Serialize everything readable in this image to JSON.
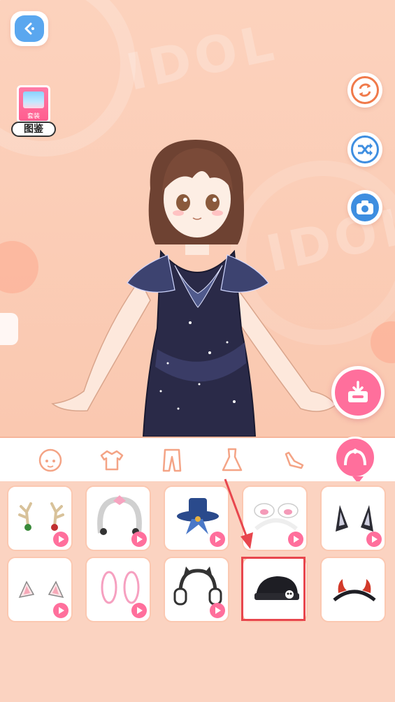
{
  "header": {
    "back_icon": "back-arrow-icon",
    "watermark": "IDOL"
  },
  "album": {
    "icon": "album-book-icon",
    "book_text": "套装",
    "label": "图鉴"
  },
  "side_buttons": [
    {
      "icon": "refresh-icon",
      "color": "#f07a4a"
    },
    {
      "icon": "shuffle-icon",
      "color": "#3e8ee0"
    },
    {
      "icon": "camera-icon",
      "color": "#3e8ee0"
    }
  ],
  "save_button": {
    "icon": "download-box-icon",
    "color": "#ff6f9c"
  },
  "categories": [
    {
      "icon": "face-icon"
    },
    {
      "icon": "top-icon"
    },
    {
      "icon": "pants-icon"
    },
    {
      "icon": "dress-icon"
    },
    {
      "icon": "shoes-icon"
    },
    {
      "icon": "headband-icon",
      "active": true
    }
  ],
  "items": [
    {
      "icon": "antler-headpiece-icon"
    },
    {
      "icon": "lace-headdress-icon"
    },
    {
      "icon": "blue-mini-hat-icon"
    },
    {
      "icon": "bunny-ear-headband-icon"
    },
    {
      "icon": "black-cat-ears-icon"
    },
    {
      "icon": "pink-cat-ears-icon"
    },
    {
      "icon": "pink-hair-clips-icon"
    },
    {
      "icon": "cat-ear-headphones-icon"
    },
    {
      "icon": "skull-cap-icon",
      "selected": true
    },
    {
      "icon": "devil-horns-headband-icon"
    }
  ],
  "colors": {
    "accent": "#ff6f9c",
    "highlight": "#e8464d",
    "background": "#fac8b0"
  }
}
